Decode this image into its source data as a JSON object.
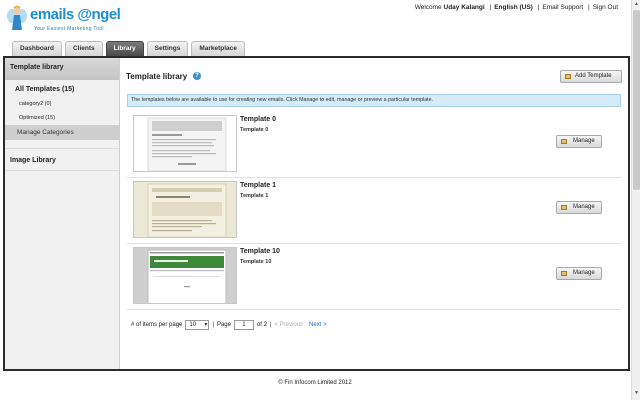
{
  "header": {
    "logo_text": "emails @ngel",
    "logo_tagline": "Your Easiest Marketing Tool",
    "welcome_prefix": "Welcome",
    "user_name": "Uday Kalangi",
    "language": "English (US)",
    "email_support": "Email Support",
    "sign_out": "Sign Out"
  },
  "tabs": [
    {
      "label": "Dashboard",
      "active": false
    },
    {
      "label": "Clients",
      "active": false
    },
    {
      "label": "Library",
      "active": true
    },
    {
      "label": "Settings",
      "active": false
    },
    {
      "label": "Marketplace",
      "active": false
    }
  ],
  "sidebar": {
    "heading": "Template library",
    "all_templates": "All Templates (15)",
    "categories": [
      "category2 (0)",
      "Optimized (15)"
    ],
    "manage_categories": "Manage Categories",
    "image_library": "Image Library"
  },
  "main": {
    "title": "Template library",
    "help_icon": "?",
    "add_button": "Add Template",
    "info": "The templates below are available to use for creating new emails. Click Manage to edit, manage or preview a particular template.",
    "templates": [
      {
        "name": "Template 0",
        "desc": "Template 0",
        "manage": "Manage"
      },
      {
        "name": "Template 1",
        "desc": "Template 1",
        "manage": "Manage"
      },
      {
        "name": "Template 10",
        "desc": "Template 10",
        "manage": "Manage"
      }
    ],
    "pager": {
      "items_label": "# of items per page",
      "items_value": "10",
      "page_label": "Page",
      "page_value": "1",
      "of_label": "of 2",
      "prev": "< Previous",
      "next": "Next >"
    }
  },
  "footer": {
    "copyright": "© Fin Infocom Limited 2012"
  },
  "colors": {
    "accent": "#1f8ed1",
    "active_tab": "#4a4a4a",
    "info_bg": "#d6ebf8",
    "link": "#1f6fb6"
  }
}
